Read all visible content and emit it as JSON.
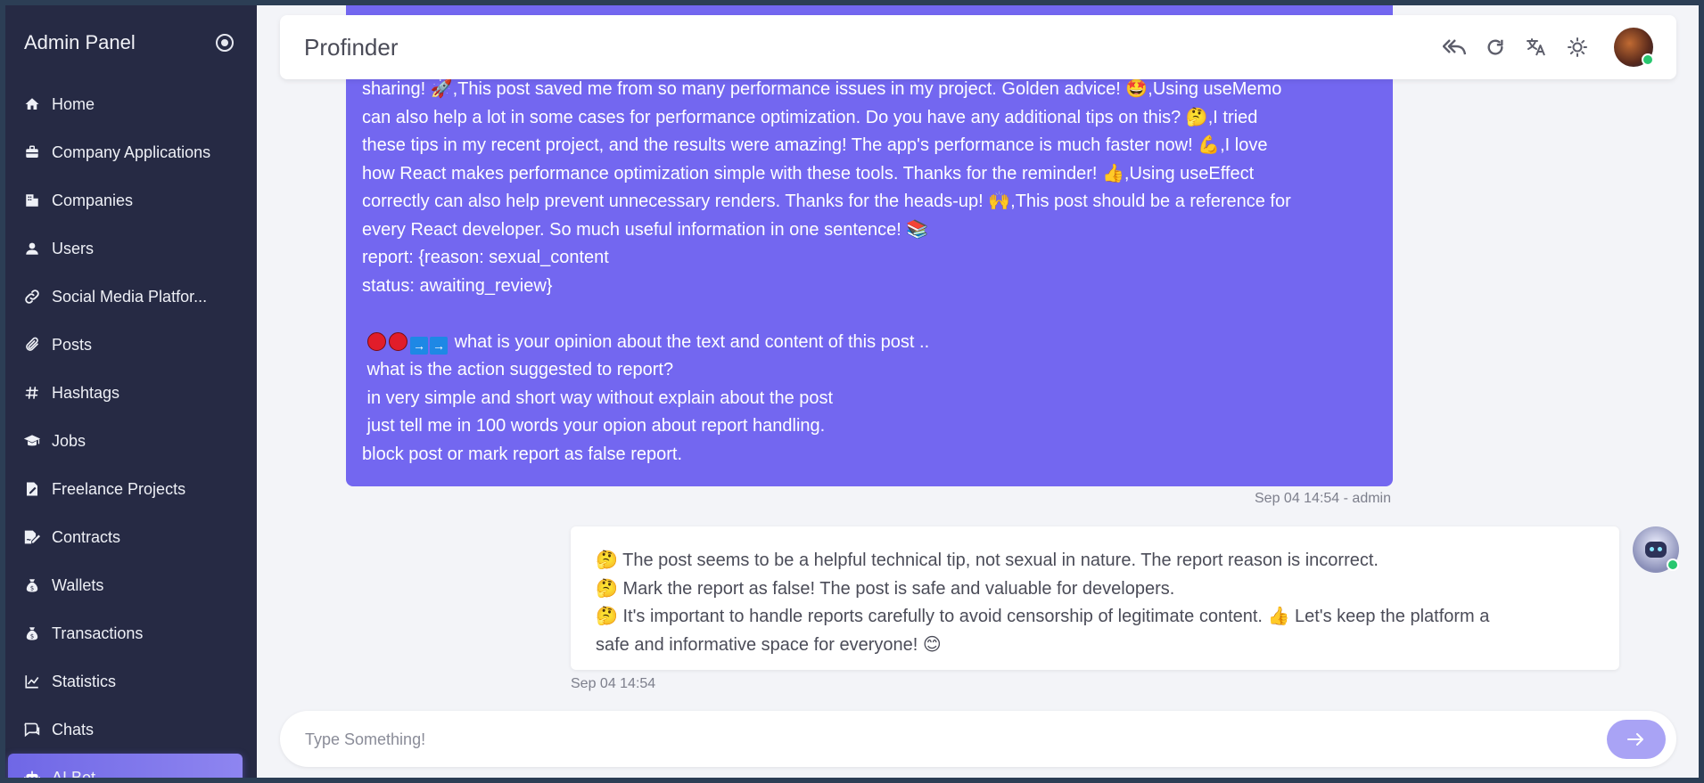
{
  "sidebar": {
    "title": "Admin Panel",
    "items": [
      {
        "label": "Home",
        "icon": "home-icon"
      },
      {
        "label": "Company Applications",
        "icon": "briefcase-icon"
      },
      {
        "label": "Companies",
        "icon": "building-icon"
      },
      {
        "label": "Users",
        "icon": "user-icon"
      },
      {
        "label": "Social Media Platfor...",
        "icon": "link-icon"
      },
      {
        "label": "Posts",
        "icon": "paperclip-icon"
      },
      {
        "label": "Hashtags",
        "icon": "hashtag-icon"
      },
      {
        "label": "Jobs",
        "icon": "graduation-cap-icon"
      },
      {
        "label": "Freelance Projects",
        "icon": "file-edit-icon"
      },
      {
        "label": "Contracts",
        "icon": "file-signature-icon"
      },
      {
        "label": "Wallets",
        "icon": "money-bag-icon"
      },
      {
        "label": "Transactions",
        "icon": "money-bag-icon"
      },
      {
        "label": "Statistics",
        "icon": "chart-line-icon"
      },
      {
        "label": "Chats",
        "icon": "chat-icon"
      },
      {
        "label": "AI Bot",
        "icon": "robot-icon",
        "active": true
      }
    ]
  },
  "topbar": {
    "title": "Profinder",
    "tools": [
      "reply-all-icon",
      "refresh-icon",
      "translate-icon",
      "sun-icon"
    ]
  },
  "chat": {
    "user_message": {
      "lines": [
        "sharing! 🚀,This post saved me from so many performance issues in my project. Golden advice! 🤩,Using useMemo",
        "can also help a lot in some cases for performance optimization. Do you have any additional tips on this? 🤔,I tried",
        "these tips in my recent project, and the results were amazing! The app's performance is much faster now! 💪,I love",
        "how React makes performance optimization simple with these tools. Thanks for the reminder! 👍,Using useEffect",
        "correctly can also help prevent unnecessary renders. Thanks for the heads-up! 🙌,This post should be a reference for",
        "every React developer. So much useful information in one sentence! 📚",
        "report: {reason: sexual_content",
        "status: awaiting_review}",
        "",
        "what is your opinion about the text and content of this post ..",
        " what is the action suggested to report?",
        " in very simple and short way without explain about the post",
        " just tell me in 100 words your opion about report handling.",
        "block post or mark report as false report."
      ],
      "time": "Sep 04 14:54 - admin"
    },
    "bot_message": {
      "lines": [
        "🤔 The post seems to be a helpful technical tip, not sexual in nature. The report reason is incorrect.",
        "🤔 Mark the report as false! The post is safe and valuable for developers.",
        "🤔 It's important to handle reports carefully to avoid censorship of legitimate content. 👍 Let's keep the platform a",
        "safe and informative space for everyone! 😊"
      ],
      "time": "Sep 04 14:54"
    }
  },
  "composer": {
    "placeholder": "Type Something!",
    "value": ""
  },
  "colors": {
    "sidebar_bg": "#262a44",
    "accent": "#7367f0",
    "online": "#28c76f"
  }
}
